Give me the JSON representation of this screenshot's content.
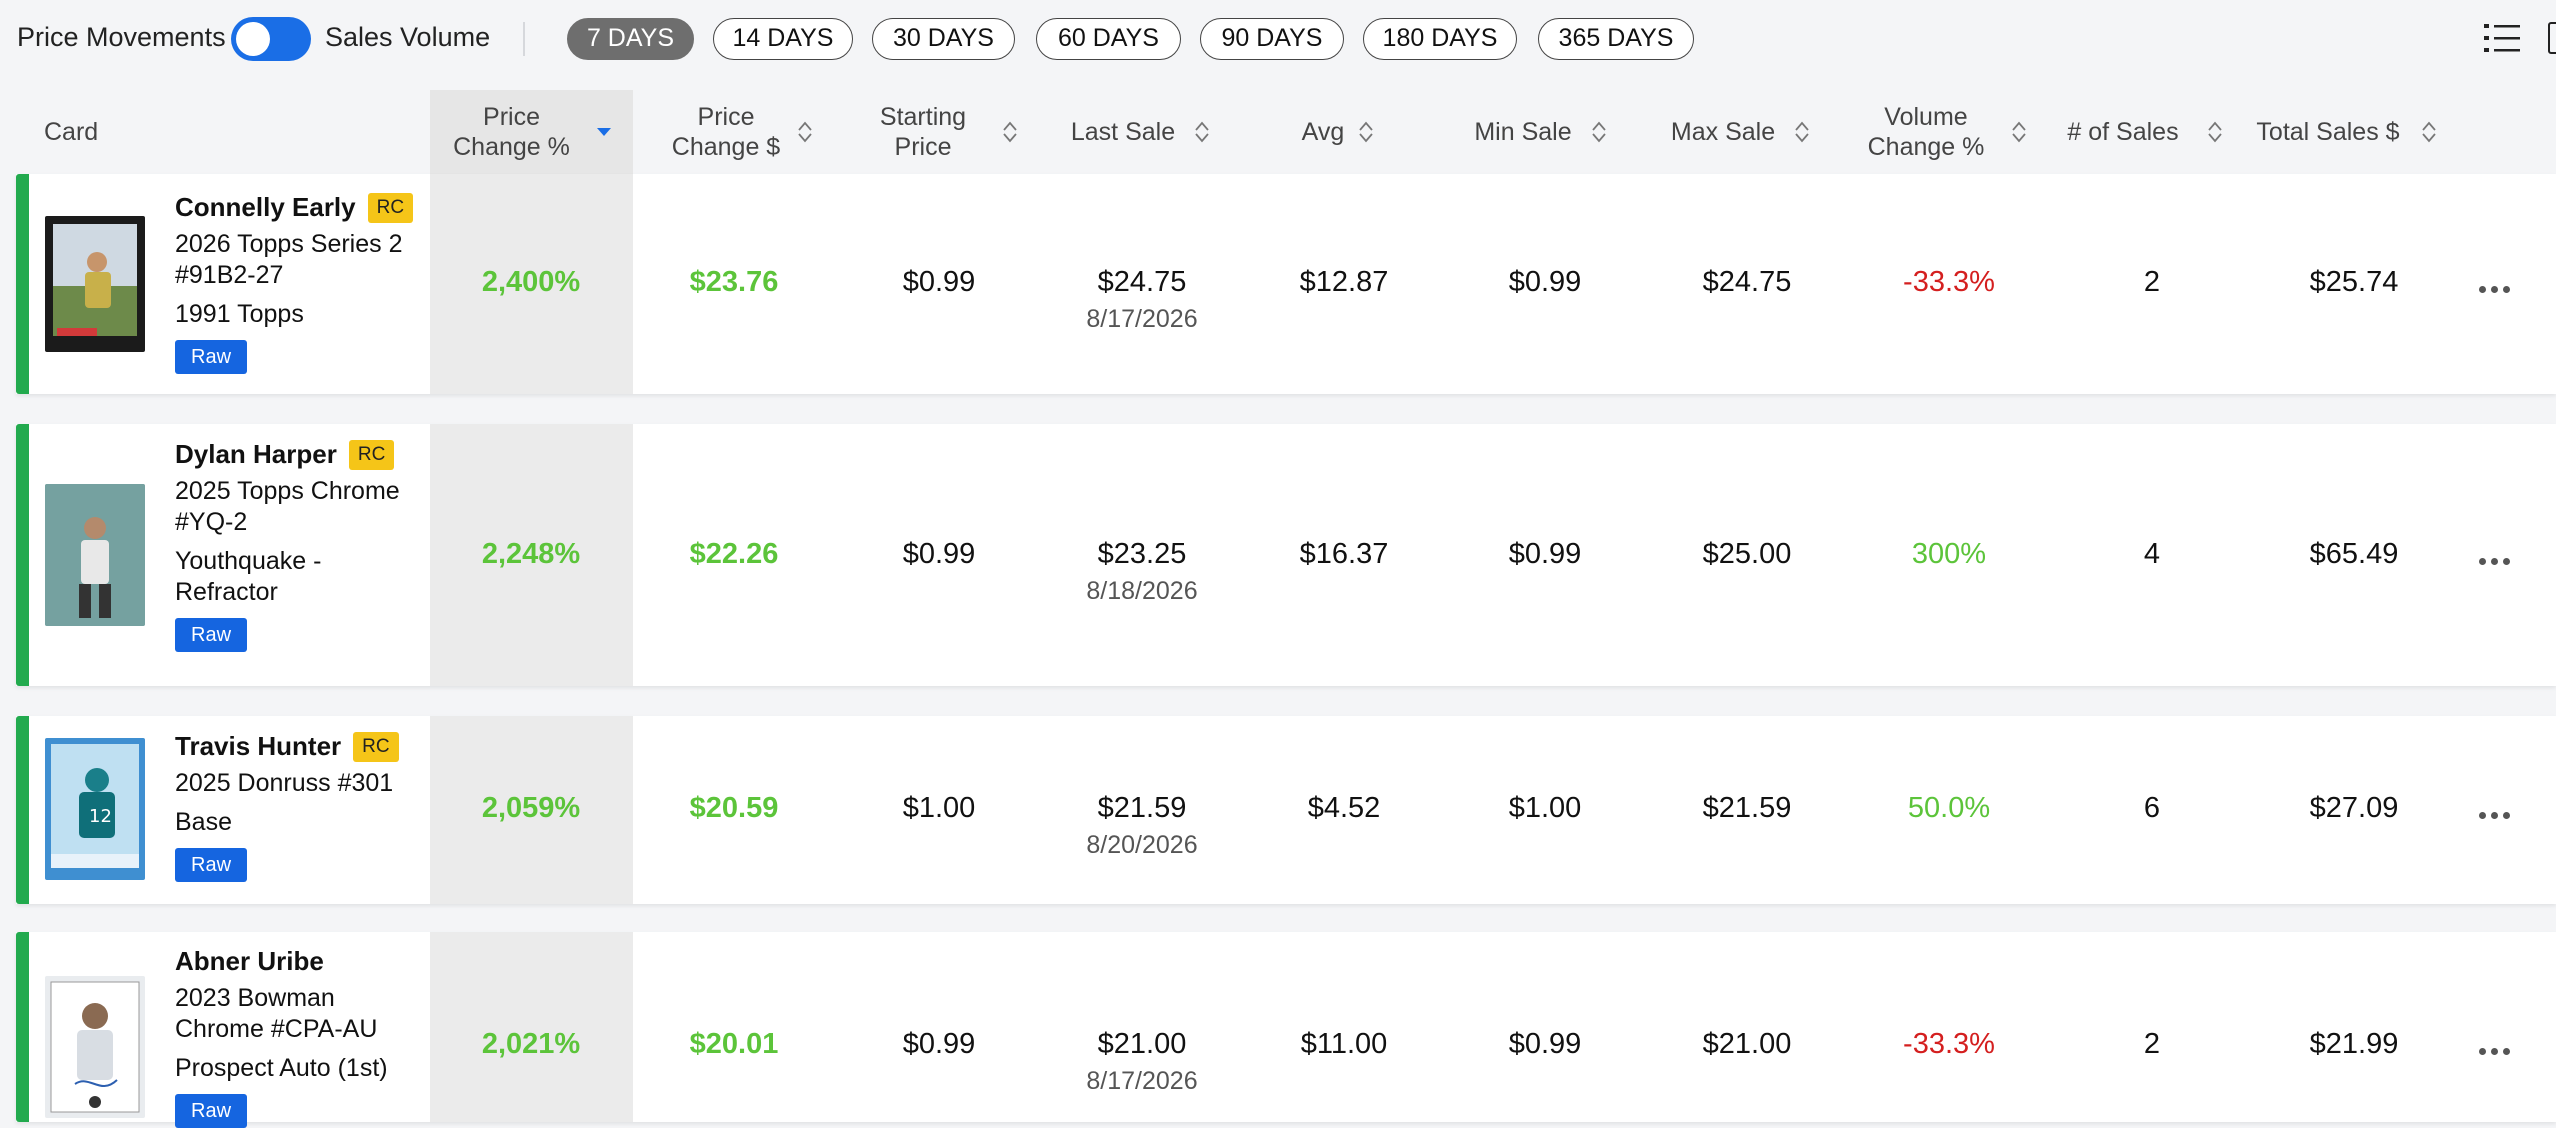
{
  "toolbar": {
    "label_left": "Price Movements",
    "label_right": "Sales Volume",
    "toggle_on": true,
    "ranges": [
      "7 DAYS",
      "14 DAYS",
      "30 DAYS",
      "60 DAYS",
      "90 DAYS",
      "180 DAYS",
      "365 DAYS"
    ],
    "active_range": "7 DAYS",
    "view_icon": "list-view-icon"
  },
  "table": {
    "header": {
      "card": "Card",
      "price_change_pct": "Price Change %",
      "price_change_usd": "Price Change $",
      "starting_price": "Starting Price",
      "last_sale": "Last Sale",
      "avg": "Avg",
      "min_sale": "Min Sale",
      "max_sale": "Max Sale",
      "volume_change": "Volume Change %",
      "num_sales": "# of Sales",
      "total_sales": "Total Sales $"
    },
    "sorted_column": "Price Change %",
    "sort_direction": "desc",
    "rows": [
      {
        "player": "Connelly Early",
        "rc": "RC",
        "set": "2026 Topps Series 2 #91B2-27",
        "variant": "1991 Topps",
        "grade": "Raw",
        "price_change_pct": "2,400%",
        "price_change_usd": "$23.76",
        "starting_price": "$0.99",
        "last_sale": "$24.75",
        "last_sale_date": "8/17/2026",
        "avg": "$12.87",
        "min_sale": "$0.99",
        "max_sale": "$24.75",
        "volume_change": "-33.3%",
        "volume_trend": "down",
        "num_sales": "2",
        "total_sales": "$25.74"
      },
      {
        "player": "Dylan Harper",
        "rc": "RC",
        "set": "2025 Topps Chrome #YQ-2",
        "variant": "Youthquake - Refractor",
        "grade": "Raw",
        "price_change_pct": "2,248%",
        "price_change_usd": "$22.26",
        "starting_price": "$0.99",
        "last_sale": "$23.25",
        "last_sale_date": "8/18/2026",
        "avg": "$16.37",
        "min_sale": "$0.99",
        "max_sale": "$25.00",
        "volume_change": "300%",
        "volume_trend": "up",
        "num_sales": "4",
        "total_sales": "$65.49"
      },
      {
        "player": "Travis Hunter",
        "rc": "RC",
        "set": "2025 Donruss #301",
        "variant": "Base",
        "grade": "Raw",
        "price_change_pct": "2,059%",
        "price_change_usd": "$20.59",
        "starting_price": "$1.00",
        "last_sale": "$21.59",
        "last_sale_date": "8/20/2026",
        "avg": "$4.52",
        "min_sale": "$1.00",
        "max_sale": "$21.59",
        "volume_change": "50.0%",
        "volume_trend": "up",
        "num_sales": "6",
        "total_sales": "$27.09"
      },
      {
        "player": "Abner Uribe",
        "rc": "",
        "set": "2023 Bowman Chrome #CPA-AU",
        "variant": "Prospect Auto (1st)",
        "grade": "Raw",
        "price_change_pct": "2,021%",
        "price_change_usd": "$20.01",
        "starting_price": "$0.99",
        "last_sale": "$21.00",
        "last_sale_date": "8/17/2026",
        "avg": "$11.00",
        "min_sale": "$0.99",
        "max_sale": "$21.00",
        "volume_change": "-33.3%",
        "volume_trend": "down",
        "num_sales": "2",
        "total_sales": "$21.99"
      }
    ]
  },
  "colors": {
    "accent": "#1a6ee6",
    "positive": "#5cc43a",
    "negative": "#d41f1f",
    "rc_badge": "#f5c518",
    "grade_badge": "#1565e0",
    "row_indicator": "#22aa4e"
  }
}
